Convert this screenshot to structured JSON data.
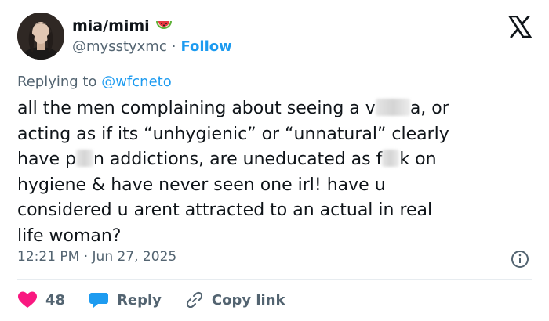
{
  "author": {
    "display_name": "mia/mimi",
    "emoji": "🍉",
    "handle": "@mysstyxmc",
    "separator": "·",
    "follow_label": "Follow"
  },
  "reply": {
    "prefix": "Replying to ",
    "mention": "@wfcneto"
  },
  "tweet": {
    "seg1": "all the men complaining about seeing a v",
    "seg2": "a, or\nacting as if its “unhygienic” or “unnatural” clearly\nhave p",
    "seg3": "n addictions, are uneducated as f",
    "seg4": "k on\nhygiene & have never seen one irl! have u\nconsidered u arent attracted to an actual in real\nlife woman?"
  },
  "meta": {
    "timestamp": "12:21 PM · Jun 27, 2025"
  },
  "actions": {
    "like_count": "48",
    "reply_label": "Reply",
    "copy_label": "Copy link"
  },
  "colors": {
    "accent": "#1d9bf0",
    "like": "#f91880",
    "muted": "#536471"
  }
}
